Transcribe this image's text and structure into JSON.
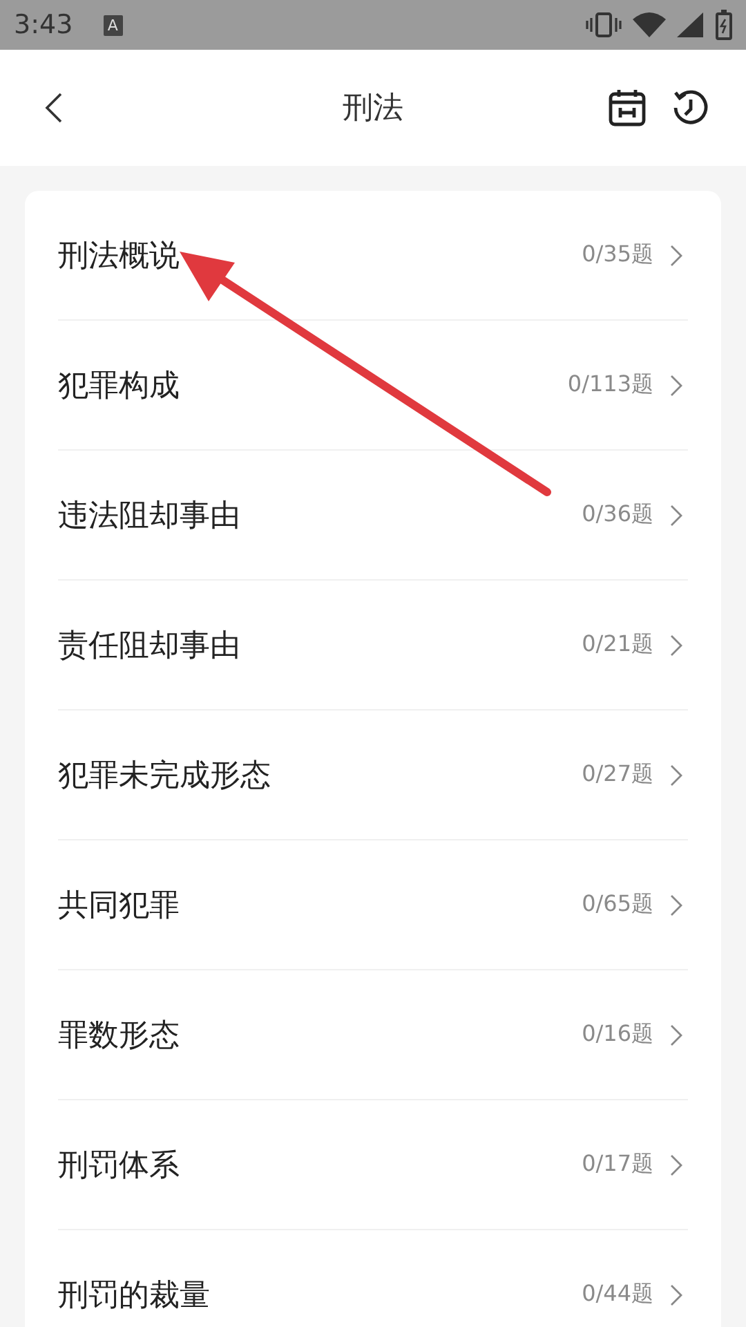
{
  "status_bar": {
    "time": "3:43",
    "keyboard_badge": "A"
  },
  "header": {
    "title": "刑法"
  },
  "chapters": [
    {
      "title": "刑法概说",
      "count": "0/35题"
    },
    {
      "title": "犯罪构成",
      "count": "0/113题"
    },
    {
      "title": "违法阻却事由",
      "count": "0/36题"
    },
    {
      "title": "责任阻却事由",
      "count": "0/21题"
    },
    {
      "title": "犯罪未完成形态",
      "count": "0/27题"
    },
    {
      "title": "共同犯罪",
      "count": "0/65题"
    },
    {
      "title": "罪数形态",
      "count": "0/16题"
    },
    {
      "title": "刑罚体系",
      "count": "0/17题"
    },
    {
      "title": "刑罚的裁量",
      "count": "0/44题"
    }
  ]
}
